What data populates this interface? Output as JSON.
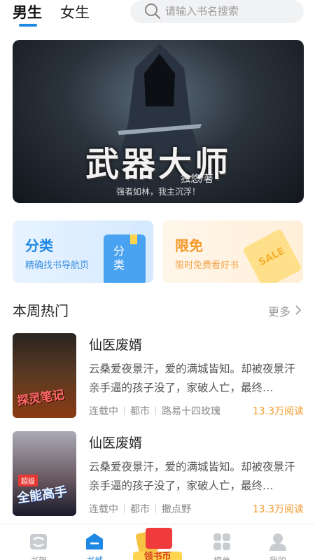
{
  "top_tabs": {
    "male": "男生",
    "female": "女生"
  },
  "search": {
    "placeholder": "请输入书名搜索"
  },
  "banner": {
    "title": "武器大师",
    "author": "独悠/著",
    "slogan": "强者如林，我主沉浮！"
  },
  "cards": {
    "category": {
      "title": "分类",
      "subtitle": "精确找书导航页",
      "icon_text": "分类"
    },
    "free": {
      "title": "限免",
      "subtitle": "限时免费看好书",
      "icon_text": "SALE"
    }
  },
  "section": {
    "title": "本周热门",
    "more": "更多"
  },
  "books": [
    {
      "title": "仙医废婿",
      "desc": "云桑爱夜景汗，爱的满城皆知。却被夜景汗亲手逼的孩子没了，家破人亡，最终…",
      "status": "连载中",
      "category": "都市",
      "author": "路易十四玫瑰",
      "reads": "13.3万阅读",
      "cover_text": "探灵笔记"
    },
    {
      "title": "仙医废婿",
      "desc": "云桑爱夜景汗，爱的满城皆知。却被夜景汗亲手逼的孩子没了，家破人亡，最终…",
      "status": "连载中",
      "category": "都市",
      "author": "撒点野",
      "reads": "13.3万阅读",
      "cover_text": "全能高手",
      "cover_badge": "超级"
    }
  ],
  "nav": {
    "shelf": "书架",
    "store": "书城",
    "gift": "领书币",
    "rank": "榜单",
    "mine": "我的"
  },
  "colors": {
    "accent": "#1e88e5",
    "orange": "#f39a2a"
  }
}
